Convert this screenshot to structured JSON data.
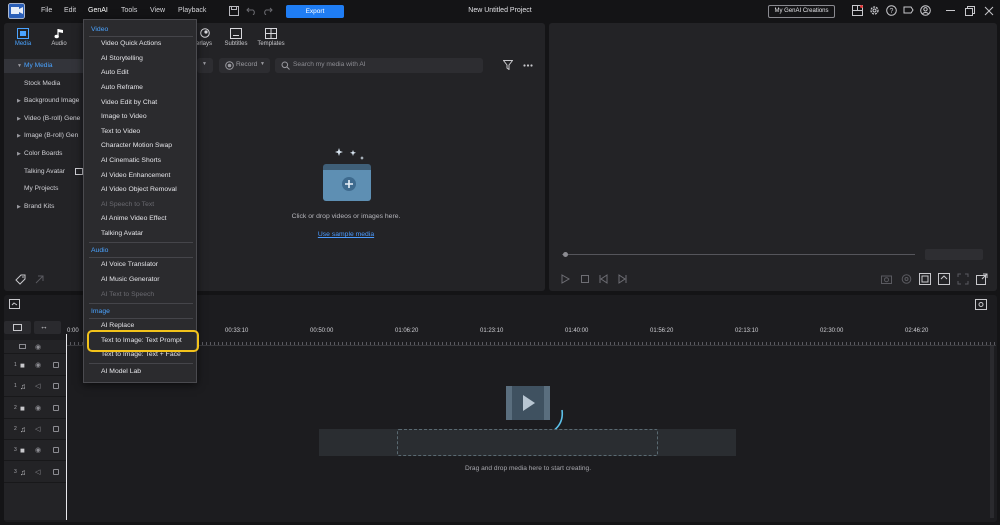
{
  "app": {
    "title": "New Untitled Project",
    "export_label": "Export",
    "my_genai_label": "My GenAI Creations",
    "accent_color": "#1f7df4",
    "highlight_color": "#f3c31b"
  },
  "menubar": {
    "file": "File",
    "edit": "Edit",
    "genai": "GenAI",
    "tools": "Tools",
    "view": "View",
    "playback": "Playback"
  },
  "media_tabs": {
    "media": "Media",
    "audio": "Audio",
    "overlays": "erlays",
    "subtitles": "Subtitles",
    "templates": "Templates"
  },
  "sidebar": {
    "items": [
      {
        "label": "My Media"
      },
      {
        "label": "Stock Media"
      },
      {
        "label": "Background Image"
      },
      {
        "label": "Video (B-roll) Gene"
      },
      {
        "label": "Image (B-roll) Gen"
      },
      {
        "label": "Color Boards"
      },
      {
        "label": "Talking Avatar"
      },
      {
        "label": "My Projects"
      },
      {
        "label": "Brand Kits"
      }
    ]
  },
  "toolbar": {
    "record_label": "Record",
    "search_placeholder": "Search my media with AI"
  },
  "media_area": {
    "drop_text": "Click or drop videos or images here.",
    "sample_link": "Use sample media"
  },
  "genai_menu": {
    "video_header": "Video",
    "video_items": [
      "Video Quick Actions",
      "AI Storytelling",
      "Auto Edit",
      "Auto Reframe",
      "Video Edit by Chat",
      "Image to Video",
      "Text to Video",
      "Character Motion Swap",
      "AI Cinematic Shorts",
      "AI Video Enhancement",
      "AI Video Object Removal",
      "AI Speech to Text",
      "AI Anime Video Effect",
      "Talking Avatar"
    ],
    "audio_header": "Audio",
    "audio_items": [
      "AI Voice Translator",
      "AI Music Generator",
      "AI Text to Speech"
    ],
    "image_header": "Image",
    "image_items": [
      "AI Replace",
      "Text to Image: Text Prompt",
      "Text to Image: Text + Face"
    ],
    "lab_item": "AI Model Lab"
  },
  "timeline": {
    "ruler": [
      "0:00",
      "00:33:10",
      "00:50:00",
      "01:06:20",
      "01:23:10",
      "01:40:00",
      "01:56:20",
      "02:13:10",
      "02:30:00",
      "02:46:20"
    ],
    "tracks": [
      "1",
      "1",
      "2",
      "2",
      "3",
      "3"
    ],
    "drop_text": "Drag and drop media here to start creating."
  }
}
